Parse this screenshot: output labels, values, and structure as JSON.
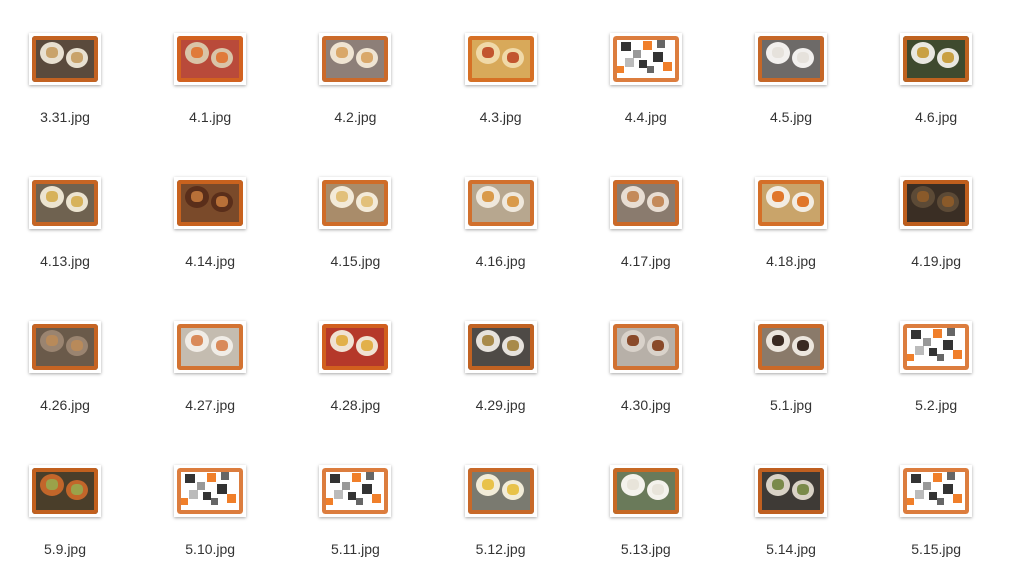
{
  "window": {
    "background": "#ffffff"
  },
  "files": [
    {
      "name": "3.31.jpg",
      "thumb": "food",
      "bg": "#5a4a3c",
      "accent": "#c9a36b",
      "plate": "#e8e0d0"
    },
    {
      "name": "4.1.jpg",
      "thumb": "food",
      "bg": "#b94a3a",
      "accent": "#e07a3a",
      "plate": "#d9c4a8"
    },
    {
      "name": "4.2.jpg",
      "thumb": "food",
      "bg": "#8d7f78",
      "accent": "#d9a86a",
      "plate": "#efe4d2"
    },
    {
      "name": "4.3.jpg",
      "thumb": "food",
      "bg": "#d8a95a",
      "accent": "#c2552f",
      "plate": "#f0d9a8"
    },
    {
      "name": "4.4.jpg",
      "thumb": "placeholder",
      "bg": "#ffffff",
      "accent": "#f07f2a",
      "plate": "#333333"
    },
    {
      "name": "4.5.jpg",
      "thumb": "food",
      "bg": "#6d6a68",
      "accent": "#e6e2dc",
      "plate": "#f2f0ee"
    },
    {
      "name": "4.6.jpg",
      "thumb": "food",
      "bg": "#3f4a2e",
      "accent": "#c9a043",
      "plate": "#e9e7e0"
    },
    {
      "name": "4.13.jpg",
      "thumb": "food",
      "bg": "#6f6250",
      "accent": "#d7b25a",
      "plate": "#ece4d0"
    },
    {
      "name": "4.14.jpg",
      "thumb": "food",
      "bg": "#7a4a2a",
      "accent": "#b87038",
      "plate": "#5a2e1a"
    },
    {
      "name": "4.15.jpg",
      "thumb": "food",
      "bg": "#a98c6a",
      "accent": "#e2c07a",
      "plate": "#f3ead8"
    },
    {
      "name": "4.16.jpg",
      "thumb": "food",
      "bg": "#b7a78f",
      "accent": "#d99a4a",
      "plate": "#efe8dc"
    },
    {
      "name": "4.17.jpg",
      "thumb": "food",
      "bg": "#8a7b6e",
      "accent": "#c48a5a",
      "plate": "#e8ddd2"
    },
    {
      "name": "4.18.jpg",
      "thumb": "food",
      "bg": "#c9a46a",
      "accent": "#e0762a",
      "plate": "#f2ece2"
    },
    {
      "name": "4.19.jpg",
      "thumb": "food",
      "bg": "#3a2e24",
      "accent": "#8a5a2a",
      "plate": "#5c4a36"
    },
    {
      "name": "4.26.jpg",
      "thumb": "food",
      "bg": "#6a5a4a",
      "accent": "#b88a5a",
      "plate": "#9a8470"
    },
    {
      "name": "4.27.jpg",
      "thumb": "food",
      "bg": "#c4bcb0",
      "accent": "#d98a5a",
      "plate": "#f0ece6"
    },
    {
      "name": "4.28.jpg",
      "thumb": "food",
      "bg": "#b5382a",
      "accent": "#e2b04a",
      "plate": "#f0e2d2"
    },
    {
      "name": "4.29.jpg",
      "thumb": "food",
      "bg": "#4e4a46",
      "accent": "#a88a4a",
      "plate": "#e6e2dc"
    },
    {
      "name": "4.30.jpg",
      "thumb": "food",
      "bg": "#b7b0a8",
      "accent": "#8a4a2a",
      "plate": "#d9d2ca"
    },
    {
      "name": "5.1.jpg",
      "thumb": "food",
      "bg": "#8a7a6a",
      "accent": "#3a2a22",
      "plate": "#ece6de"
    },
    {
      "name": "5.2.jpg",
      "thumb": "placeholder",
      "bg": "#ffffff",
      "accent": "#f07f2a",
      "plate": "#333333"
    },
    {
      "name": "5.9.jpg",
      "thumb": "food",
      "bg": "#4a3e2a",
      "accent": "#9aa24a",
      "plate": "#c2662a"
    },
    {
      "name": "5.10.jpg",
      "thumb": "placeholder",
      "bg": "#ffffff",
      "accent": "#f07f2a",
      "plate": "#333333"
    },
    {
      "name": "5.11.jpg",
      "thumb": "placeholder",
      "bg": "#ffffff",
      "accent": "#f07f2a",
      "plate": "#333333"
    },
    {
      "name": "5.12.jpg",
      "thumb": "food",
      "bg": "#7a7a70",
      "accent": "#e8c24a",
      "plate": "#f2ecd8"
    },
    {
      "name": "5.13.jpg",
      "thumb": "food",
      "bg": "#6a7a5a",
      "accent": "#e8e4da",
      "plate": "#f4f2ec"
    },
    {
      "name": "5.14.jpg",
      "thumb": "food",
      "bg": "#3e3a36",
      "accent": "#7a8a4a",
      "plate": "#d9d2c6"
    },
    {
      "name": "5.15.jpg",
      "thumb": "placeholder",
      "bg": "#ffffff",
      "accent": "#f07f2a",
      "plate": "#333333"
    }
  ]
}
